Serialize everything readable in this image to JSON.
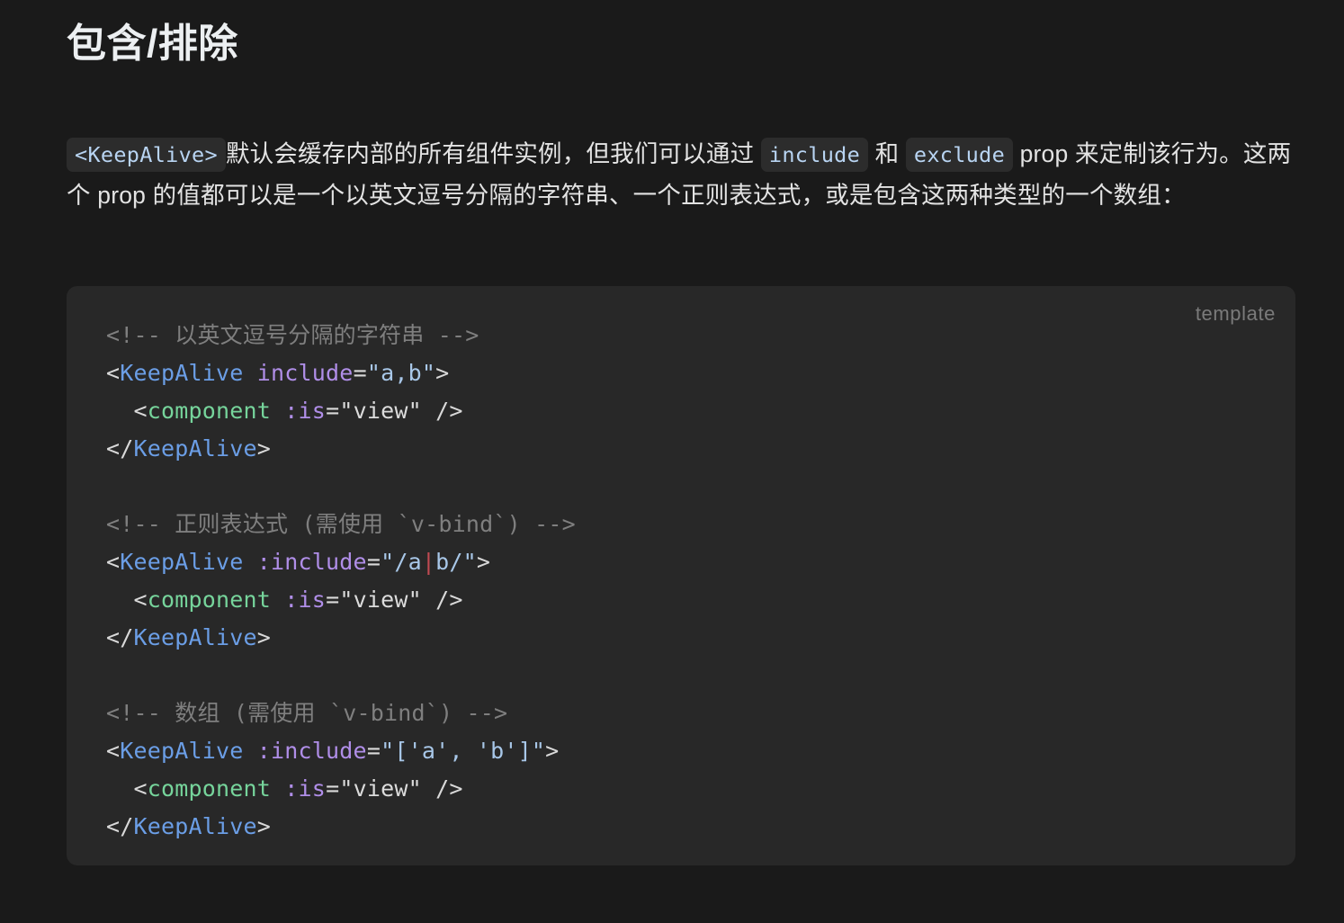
{
  "page": {
    "title": "包含/排除",
    "background_color": "#1a1a1a"
  },
  "intro": {
    "chip_keepalive": "<KeepAlive>",
    "text_1": "默认会缓存内部的所有组件实例，但我们可以通过 ",
    "chip_include": "include",
    "text_2": " 和 ",
    "chip_exclude": "exclude",
    "text_3": " prop 来定制该行为。这两个 prop 的值都可以是一个以英文逗号分隔的字符串、一个正则表达式，或是包含这两种类型的一个数组："
  },
  "code_block": {
    "language_label": "template",
    "background_color": "#282828",
    "lines": [
      {
        "tokens": [
          {
            "t": "<!-- 以英文逗号分隔的字符串 -->",
            "c": "t-comment"
          }
        ]
      },
      {
        "tokens": [
          {
            "t": "<",
            "c": "t-punct"
          },
          {
            "t": "KeepAlive",
            "c": "t-tag"
          },
          {
            "t": " ",
            "c": "t-plain"
          },
          {
            "t": "include",
            "c": "t-attr"
          },
          {
            "t": "=",
            "c": "t-op"
          },
          {
            "t": "\"a,b\"",
            "c": "t-string"
          },
          {
            "t": ">",
            "c": "t-punct"
          }
        ]
      },
      {
        "tokens": [
          {
            "t": "  <",
            "c": "t-punct"
          },
          {
            "t": "component",
            "c": "t-comp"
          },
          {
            "t": " ",
            "c": "t-plain"
          },
          {
            "t": ":is",
            "c": "t-attr"
          },
          {
            "t": "=",
            "c": "t-op"
          },
          {
            "t": "\"view\"",
            "c": "t-plain"
          },
          {
            "t": " />",
            "c": "t-punct"
          }
        ]
      },
      {
        "tokens": [
          {
            "t": "</",
            "c": "t-punct"
          },
          {
            "t": "KeepAlive",
            "c": "t-tag"
          },
          {
            "t": ">",
            "c": "t-punct"
          }
        ]
      },
      {
        "tokens": [
          {
            "t": "",
            "c": "t-plain"
          }
        ]
      },
      {
        "tokens": [
          {
            "t": "<!-- 正则表达式 (需使用 `v-bind`) -->",
            "c": "t-comment"
          }
        ]
      },
      {
        "tokens": [
          {
            "t": "<",
            "c": "t-punct"
          },
          {
            "t": "KeepAlive",
            "c": "t-tag"
          },
          {
            "t": " ",
            "c": "t-plain"
          },
          {
            "t": ":include",
            "c": "t-attr"
          },
          {
            "t": "=",
            "c": "t-op"
          },
          {
            "t": "\"/a",
            "c": "t-regex"
          },
          {
            "t": "|",
            "c": "t-alt"
          },
          {
            "t": "b/\"",
            "c": "t-regex"
          },
          {
            "t": ">",
            "c": "t-punct"
          }
        ]
      },
      {
        "tokens": [
          {
            "t": "  <",
            "c": "t-punct"
          },
          {
            "t": "component",
            "c": "t-comp"
          },
          {
            "t": " ",
            "c": "t-plain"
          },
          {
            "t": ":is",
            "c": "t-attr"
          },
          {
            "t": "=",
            "c": "t-op"
          },
          {
            "t": "\"view\"",
            "c": "t-plain"
          },
          {
            "t": " />",
            "c": "t-punct"
          }
        ]
      },
      {
        "tokens": [
          {
            "t": "</",
            "c": "t-punct"
          },
          {
            "t": "KeepAlive",
            "c": "t-tag"
          },
          {
            "t": ">",
            "c": "t-punct"
          }
        ]
      },
      {
        "tokens": [
          {
            "t": "",
            "c": "t-plain"
          }
        ]
      },
      {
        "tokens": [
          {
            "t": "<!-- 数组 (需使用 `v-bind`) -->",
            "c": "t-comment"
          }
        ]
      },
      {
        "tokens": [
          {
            "t": "<",
            "c": "t-punct"
          },
          {
            "t": "KeepAlive",
            "c": "t-tag"
          },
          {
            "t": " ",
            "c": "t-plain"
          },
          {
            "t": ":include",
            "c": "t-attr"
          },
          {
            "t": "=",
            "c": "t-op"
          },
          {
            "t": "\"['a', 'b']\"",
            "c": "t-string"
          },
          {
            "t": ">",
            "c": "t-punct"
          }
        ]
      },
      {
        "tokens": [
          {
            "t": "  <",
            "c": "t-punct"
          },
          {
            "t": "component",
            "c": "t-comp"
          },
          {
            "t": " ",
            "c": "t-plain"
          },
          {
            "t": ":is",
            "c": "t-attr"
          },
          {
            "t": "=",
            "c": "t-op"
          },
          {
            "t": "\"view\"",
            "c": "t-plain"
          },
          {
            "t": " />",
            "c": "t-punct"
          }
        ]
      },
      {
        "tokens": [
          {
            "t": "</",
            "c": "t-punct"
          },
          {
            "t": "KeepAlive",
            "c": "t-tag"
          },
          {
            "t": ">",
            "c": "t-punct"
          }
        ]
      }
    ]
  }
}
